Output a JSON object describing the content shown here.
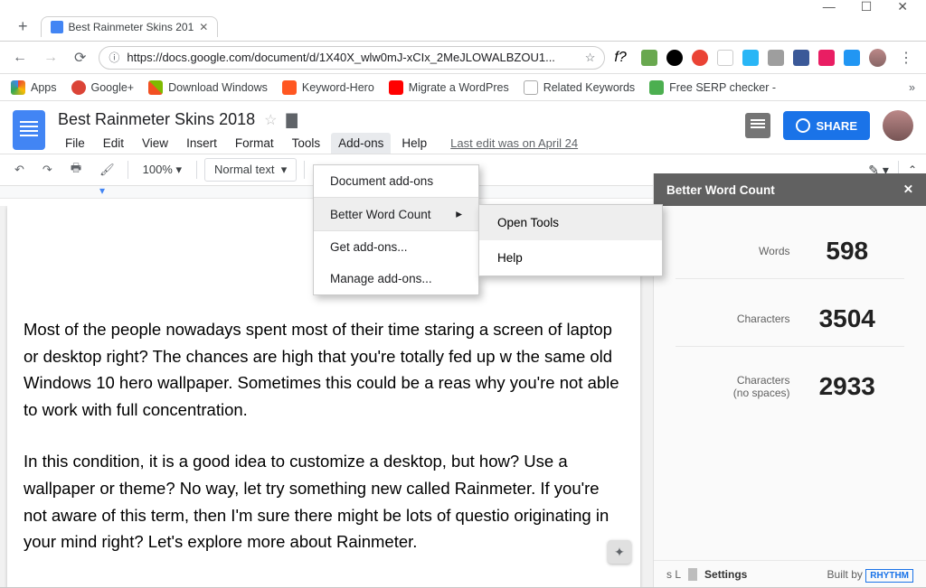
{
  "window": {
    "min": "—",
    "max": "☐",
    "close": "✕"
  },
  "tab": {
    "title": "Best Rainmeter Skins 201"
  },
  "nav": {
    "url": "https://docs.google.com/document/d/1X40X_wlw0mJ-xCIx_2MeJLOWALBZOU1...",
    "f_q": "f?"
  },
  "bookmarks": {
    "apps": "Apps",
    "gplus": "Google+",
    "dlwin": "Download Windows",
    "kh": "Keyword-Hero",
    "mig": "Migrate a WordPres",
    "rk": "Related Keywords",
    "serp": "Free SERP checker -"
  },
  "docs": {
    "title": "Best Rainmeter Skins 2018",
    "menus": {
      "file": "File",
      "edit": "Edit",
      "view": "View",
      "insert": "Insert",
      "format": "Format",
      "tools": "Tools",
      "addons": "Add-ons",
      "help": "Help"
    },
    "lastedit": "Last edit was on April 24",
    "share": "SHARE",
    "zoom": "100%",
    "style": "Normal text"
  },
  "addons_menu": {
    "doc_addons": "Document add-ons",
    "bwc": "Better Word Count",
    "get": "Get add-ons...",
    "manage": "Manage add-ons...",
    "arrow": "▸"
  },
  "submenu": {
    "open": "Open Tools",
    "help": "Help"
  },
  "doc_body": {
    "p1": "Most of the people nowadays spent most of their time staring a screen of laptop or desktop right? The chances are high that you're totally fed up w the same old Windows 10 hero wallpaper. Sometimes this could be a reas why you're not able to work with full concentration.",
    "p2": "In this condition, it is a good idea to customize a desktop, but how? Use a wallpaper or theme? No way, let try something new called Rainmeter. If you're not aware of this term, then I'm sure there might be lots of questio originating in your mind right? Let's explore more about Rainmeter."
  },
  "sidebar": {
    "title": "Better Word Count",
    "close": "✕",
    "words_label": "Words",
    "words": "598",
    "chars_label": "Characters",
    "chars": "3504",
    "charsns_label1": "Characters",
    "charsns_label2": "(no spaces)",
    "charsns": "2933",
    "sl": "s L",
    "settings": "Settings",
    "builtby": "Built by",
    "rhythm": "RHYTHM"
  }
}
